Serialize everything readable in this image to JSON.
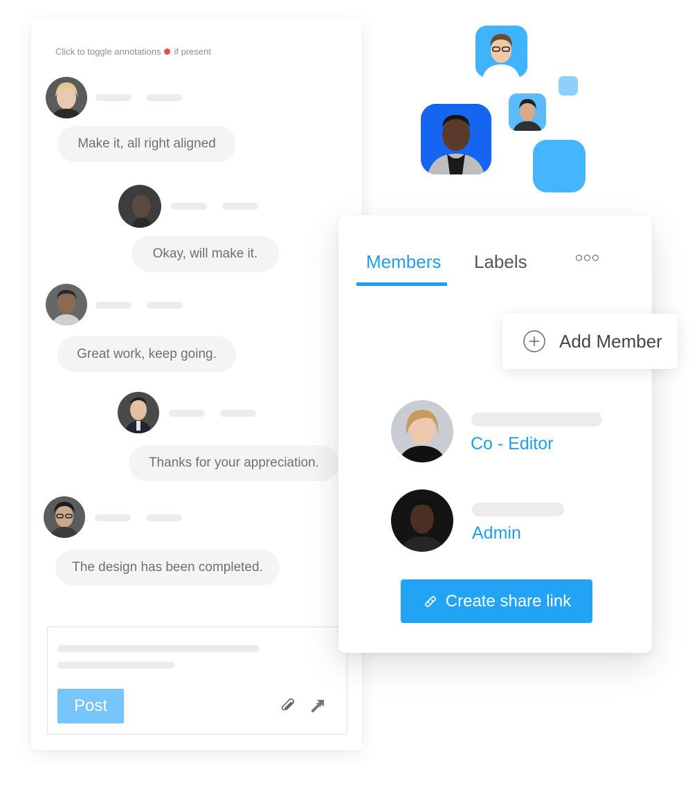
{
  "chat": {
    "hint_text": "Click to toggle annotations",
    "hint_suffix": "if present",
    "messages": [
      {
        "text": "Make it, all right aligned"
      },
      {
        "text": "Okay, will make it."
      },
      {
        "text": "Great work, keep going."
      },
      {
        "text": "Thanks for your appreciation."
      },
      {
        "text": "The design has been completed."
      }
    ],
    "composer": {
      "post_label": "Post"
    }
  },
  "members_panel": {
    "tabs": [
      {
        "label": "Members",
        "active": true
      },
      {
        "label": "Labels",
        "active": false
      }
    ],
    "add_member_label": "Add Member",
    "members": [
      {
        "role": "Co - Editor"
      },
      {
        "role": "Admin"
      }
    ],
    "share_button_label": "Create share link"
  },
  "colors": {
    "accent": "#1f9df0",
    "post_button": "#76c6fb",
    "bubble_bg": "#f4f4f4",
    "hint_dot": "#f04a45",
    "blob": "#45b6fe"
  },
  "icons": {
    "more": "more-dots-icon",
    "add": "plus-circle-icon",
    "attach": "paperclip-icon",
    "send": "send-arrow-icon",
    "link": "link-icon"
  }
}
